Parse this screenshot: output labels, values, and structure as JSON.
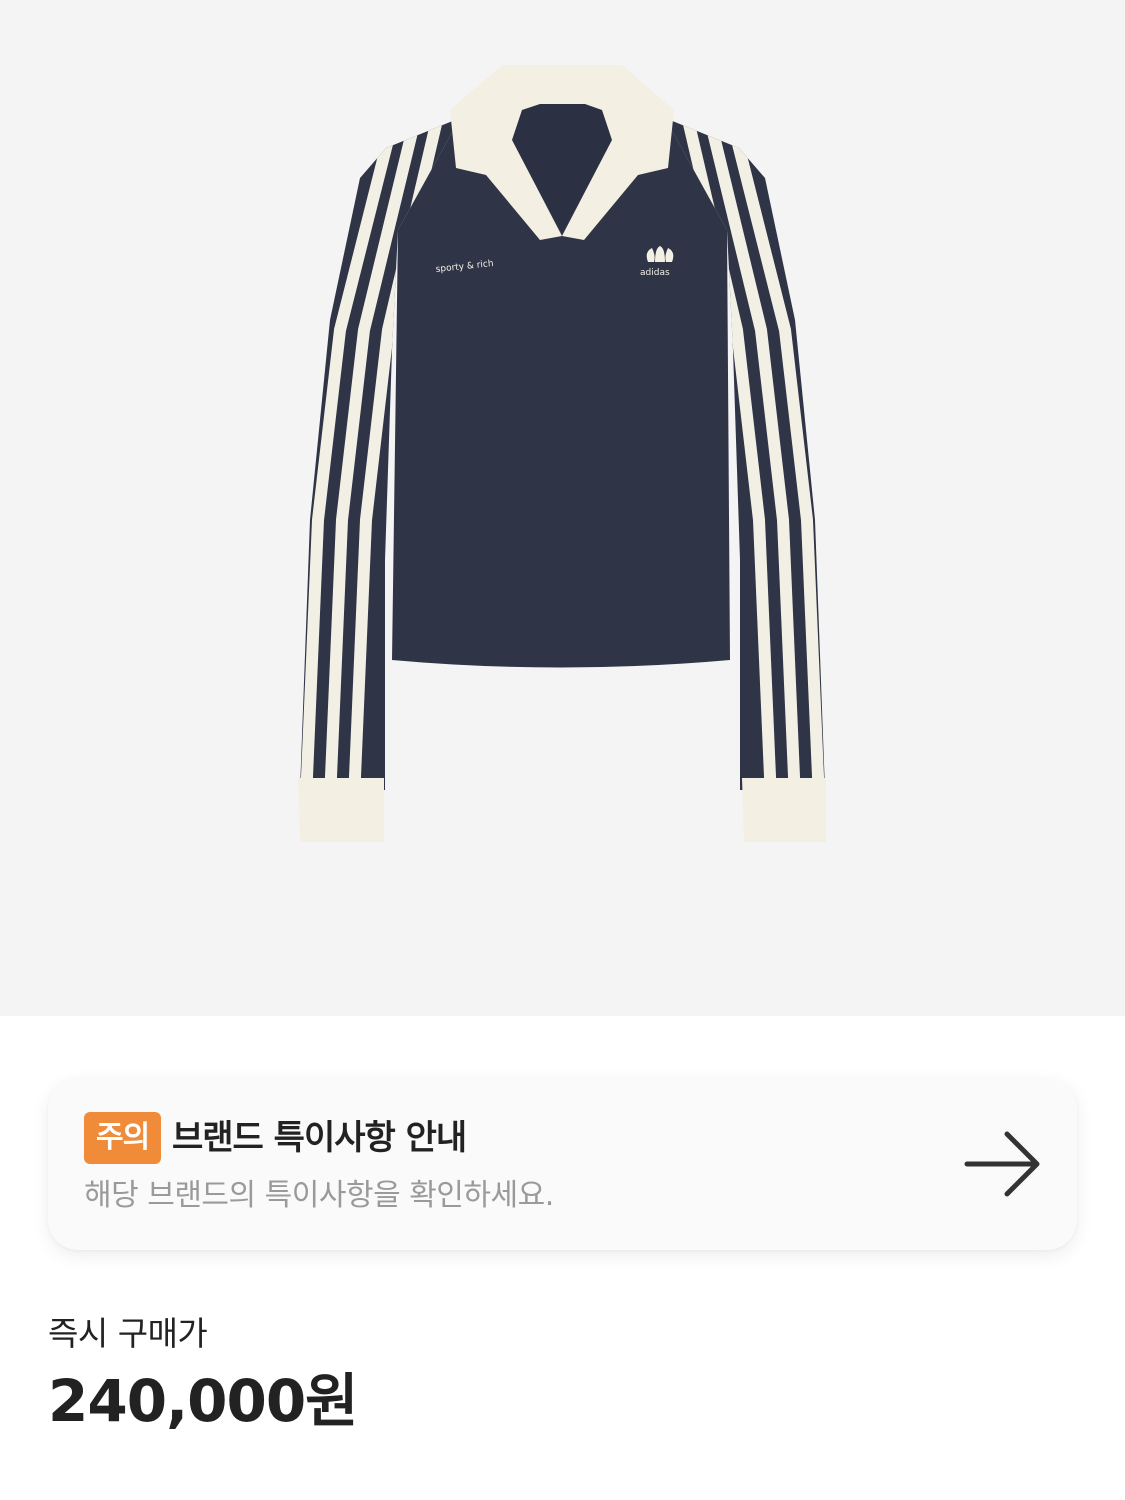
{
  "product": {
    "image_alt": "product-image",
    "chest_text": "sporty & rich",
    "logo_text": "adidas"
  },
  "notice": {
    "badge": "주의",
    "title": "브랜드 특이사항 안내",
    "subtitle": "해당 브랜드의 특이사항을 확인하세요.",
    "badge_color": "#ef8b39",
    "arrow_icon": "arrow-right-icon"
  },
  "price": {
    "label": "즉시 구매가",
    "value": "240,000원"
  }
}
